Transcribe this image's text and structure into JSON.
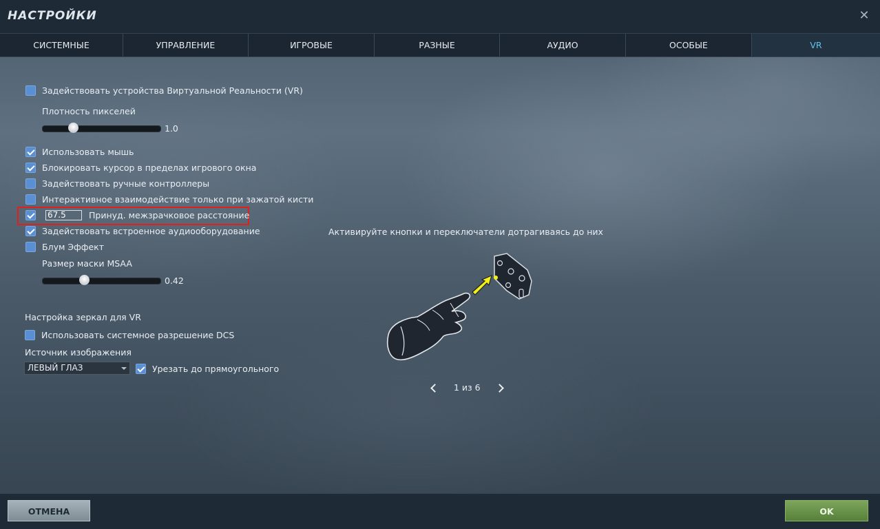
{
  "window": {
    "title": "НАСТРОЙКИ"
  },
  "tabs": [
    {
      "label": "СИСТЕМНЫЕ",
      "active": false
    },
    {
      "label": "УПРАВЛЕНИЕ",
      "active": false
    },
    {
      "label": "ИГРОВЫЕ",
      "active": false
    },
    {
      "label": "РАЗНЫЕ",
      "active": false
    },
    {
      "label": "АУДИО",
      "active": false
    },
    {
      "label": "ОСОБЫЕ",
      "active": false
    },
    {
      "label": "VR",
      "active": true
    }
  ],
  "vr": {
    "enable_vr": {
      "label": "Задействовать устройства Виртуальной Реальности (VR)",
      "checked": false
    },
    "pixel_density": {
      "label": "Плотность пикселей",
      "value": "1.0",
      "fraction": 0.26
    },
    "use_mouse": {
      "label": "Использовать мышь",
      "checked": true
    },
    "lock_cursor": {
      "label": "Блокировать курсор в пределах игрового окна",
      "checked": true
    },
    "hand_controllers": {
      "label": "Задействовать ручные контроллеры",
      "checked": false
    },
    "interactive_grip": {
      "label": "Интерактивное взаимодействие только при зажатой кисти",
      "checked": false
    },
    "force_ipd": {
      "label": "Принуд. межзрачковое расстояние",
      "checked": true,
      "value": "67.5"
    },
    "builtin_audio": {
      "label": "Задействовать встроенное аудиооборудование",
      "checked": true
    },
    "bloom": {
      "label": "Блум Эффект",
      "checked": false
    },
    "msaa_mask": {
      "label": "Размер маски MSAA",
      "value": "0.42",
      "fraction": 0.36
    },
    "mirror_header": "Настройка зеркал для VR",
    "system_resolution": {
      "label": "Использовать системное разрешение DCS",
      "checked": false
    },
    "image_source": {
      "label": "Источник изображения",
      "selected": "ЛЕВЫЙ ГЛАЗ"
    },
    "crop_rect": {
      "label": "Урезать до прямоугольного",
      "checked": true
    }
  },
  "hint": {
    "text": "Активируйте кнопки и переключатели дотрагиваясь до них",
    "page": "1 из 6",
    "colors": {
      "arrow": "#f2f01a",
      "glove": "#1f2630"
    }
  },
  "footer": {
    "cancel_label": "ОТМЕНА",
    "ok_label": "OK"
  }
}
